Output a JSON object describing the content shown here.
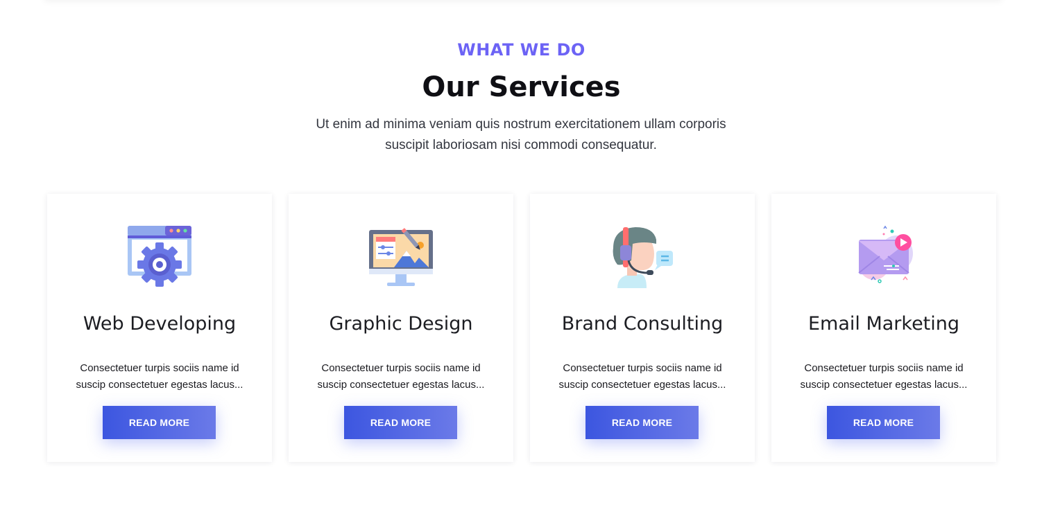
{
  "section": {
    "kicker": "WHAT WE DO",
    "title": "Our Services",
    "intro": "Ut enim ad minima veniam quis nostrum exercitationem ullam corporis suscipit laboriosam nisi commodi consequatur."
  },
  "colors": {
    "kicker": "#6c63f5",
    "button_start": "#3c56e0",
    "button_end": "#6b7ae8"
  },
  "services": [
    {
      "icon": "web-developing-icon",
      "title": "Web Developing",
      "text": "Consectetuer turpis sociis name id suscip consectetuer egestas lacus...",
      "button": "READ MORE"
    },
    {
      "icon": "graphic-design-icon",
      "title": "Graphic Design",
      "text": "Consectetuer turpis sociis name id suscip consectetuer egestas lacus...",
      "button": "READ MORE"
    },
    {
      "icon": "brand-consulting-icon",
      "title": "Brand Consulting",
      "text": "Consectetuer turpis sociis name id suscip consectetuer egestas lacus...",
      "button": "READ MORE"
    },
    {
      "icon": "email-marketing-icon",
      "title": "Email Marketing",
      "text": "Consectetuer turpis sociis name id suscip consectetuer egestas lacus...",
      "button": "READ MORE"
    }
  ]
}
